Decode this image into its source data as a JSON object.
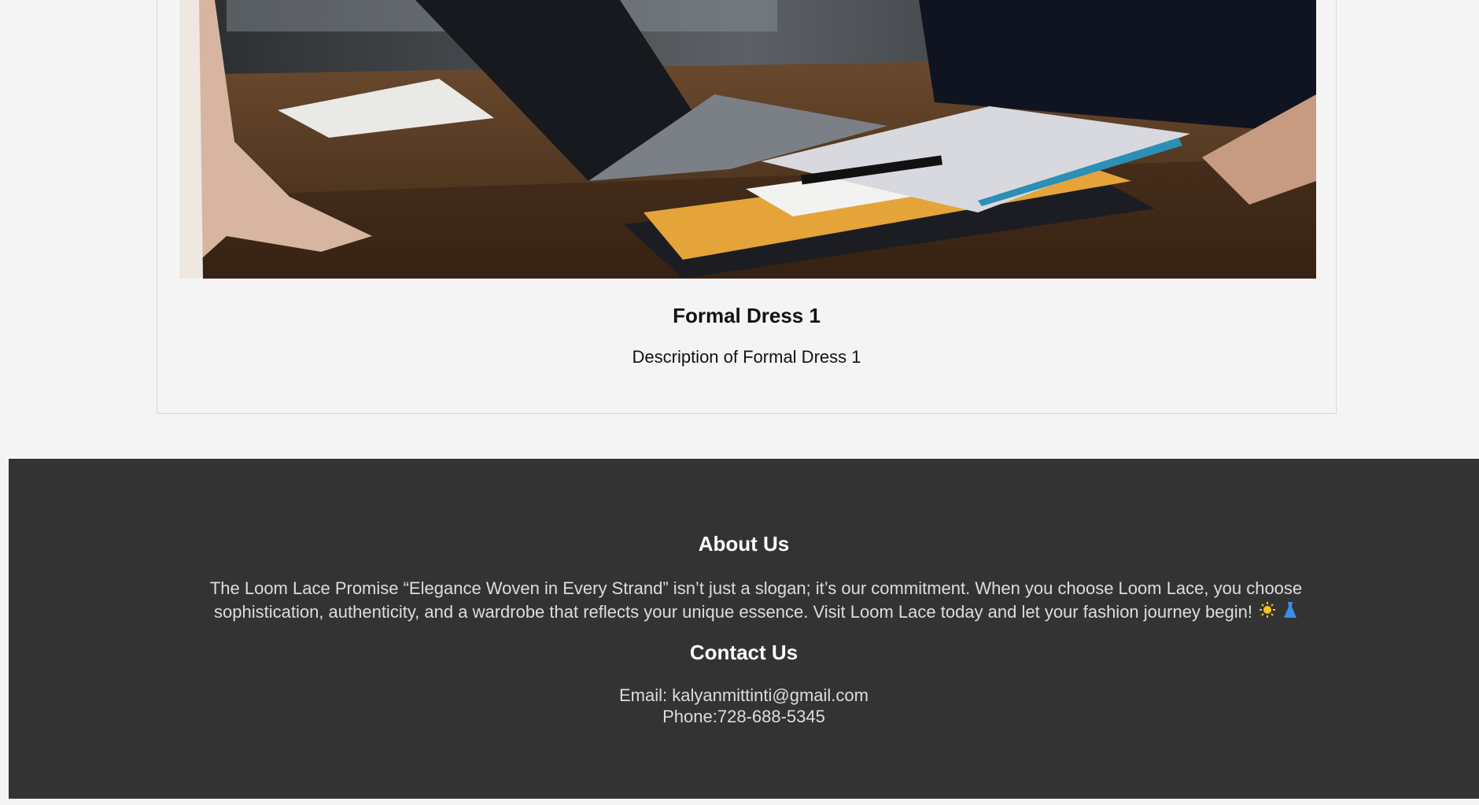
{
  "product": {
    "title": "Formal Dress 1",
    "description": "Description of Formal Dress 1"
  },
  "footer": {
    "about_title": "About Us",
    "about_text": "The Loom Lace Promise “Elegance Woven in Every Strand” isn’t just a slogan; it’s our commitment. When you choose Loom Lace, you choose sophistication, authenticity, and a wardrobe that reflects your unique essence. Visit Loom Lace today and let your fashion journey begin!",
    "contact_title": "Contact Us",
    "email_line": "Email: kalyanmittinti@gmail.com",
    "phone_line": "Phone:728-688-5345",
    "icons": [
      "sun-icon",
      "dress-icon"
    ]
  },
  "colors": {
    "page_background": "#f4f4f4",
    "footer_background": "#333333",
    "footer_heading": "#ffffff",
    "footer_text": "#dddddd"
  }
}
